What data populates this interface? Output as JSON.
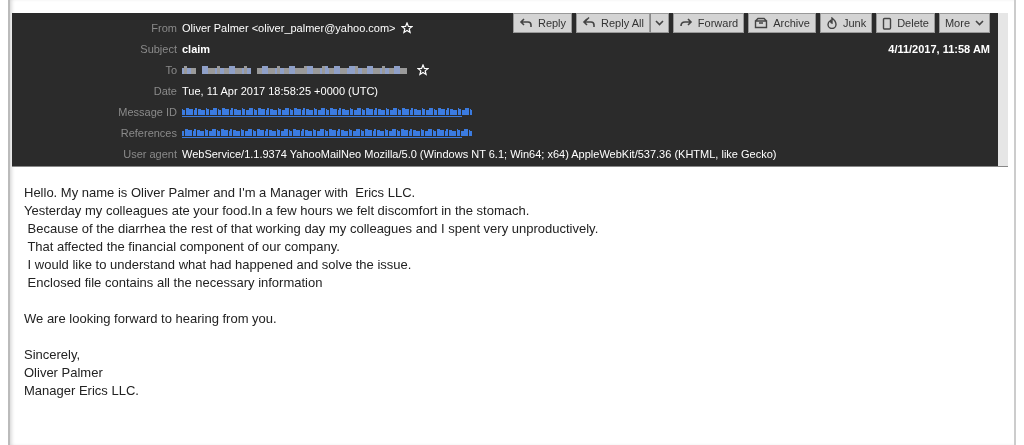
{
  "toolbar": [
    {
      "label": "Reply",
      "kind": "reply"
    },
    {
      "label": "Reply All",
      "kind": "reply-all-split"
    },
    {
      "label": "Forward",
      "kind": "forward"
    },
    {
      "label": "Archive",
      "kind": "archive"
    },
    {
      "label": "Junk",
      "kind": "junk"
    },
    {
      "label": "Delete",
      "kind": "delete"
    },
    {
      "label": "More",
      "kind": "more"
    }
  ],
  "headers": [
    {
      "label": "From",
      "kind": "contact",
      "value": "Oliver Palmer <oliver_palmer@yahoo.com>"
    },
    {
      "label": "Subject",
      "kind": "subject",
      "value": "claim"
    },
    {
      "label": "To",
      "kind": "redacted-contact"
    },
    {
      "label": "Date",
      "kind": "text",
      "value": "Tue, 11 Apr 2017 18:58:25 +0000 (UTC)"
    },
    {
      "label": "Message ID",
      "kind": "redacted-link"
    },
    {
      "label": "References",
      "kind": "redacted-link"
    },
    {
      "label": "User agent",
      "kind": "text",
      "value": "WebService/1.1.9374 YahooMailNeo Mozilla/5.0 (Windows NT 6.1; Win64; x64) AppleWebKit/537.36 (KHTML, like Gecko)"
    }
  ],
  "received": "4/11/2017, 11:58 AM",
  "body": [
    [
      "Hello. My name is Oliver Palmer and I'm a Manager with  Erics LLC.",
      "Yesterday my colleagues ate your food.In a few hours we felt discomfort in the stomach.",
      " Because of the diarrhea the rest of that working day my colleagues and I spent very unproductively.",
      " That affected the financial component of our company.",
      " I would like to understand what had happened and solve the issue.",
      " Enclosed file contains all the necessary information"
    ],
    [
      "We are looking forward to hearing from you."
    ],
    [
      "Sincerely,",
      "Oliver Palmer",
      "Manager Erics LLC."
    ]
  ]
}
